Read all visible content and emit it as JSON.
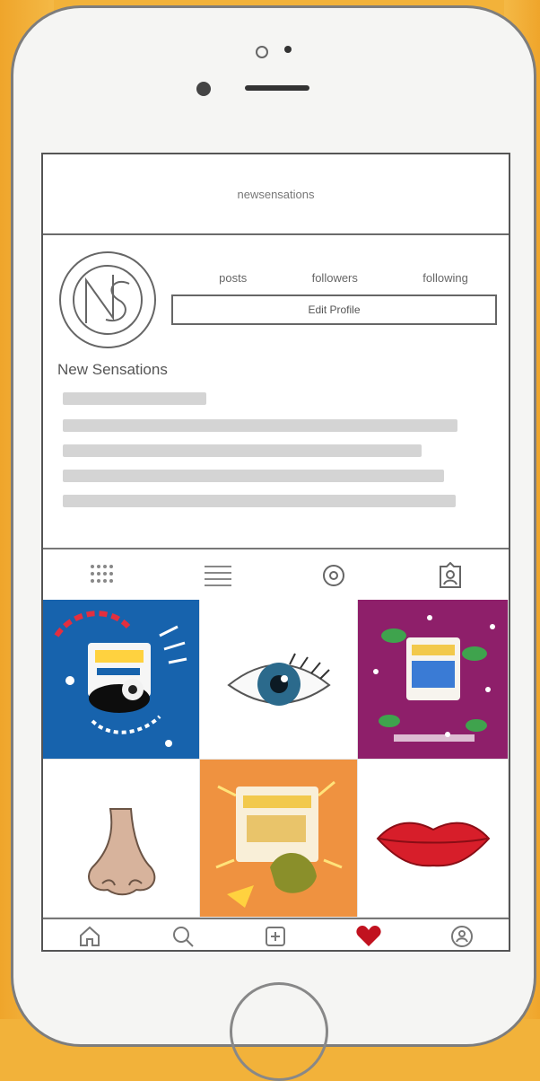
{
  "header": {
    "username": "newsensations"
  },
  "profile": {
    "stats": [
      {
        "label": "posts"
      },
      {
        "label": "followers"
      },
      {
        "label": "following"
      }
    ],
    "edit_button_label": "Edit Profile",
    "display_name": "New Sensations"
  },
  "tabs": [
    {
      "name": "grid",
      "icon": "grid-icon"
    },
    {
      "name": "list",
      "icon": "list-icon"
    },
    {
      "name": "location",
      "icon": "location-icon"
    },
    {
      "name": "tagged",
      "icon": "tagged-icon"
    }
  ],
  "posts": [
    {
      "subject": "blue poster",
      "color": "#1763ad"
    },
    {
      "subject": "eye",
      "color": "#2b6a8c"
    },
    {
      "subject": "magenta poster",
      "color": "#8e1f6a"
    },
    {
      "subject": "nose",
      "color": "#d7b39c"
    },
    {
      "subject": "orange poster",
      "color": "#ef9240"
    },
    {
      "subject": "lips",
      "color": "#d71e2a"
    }
  ],
  "bottom_nav": [
    {
      "name": "home",
      "icon": "home-icon"
    },
    {
      "name": "search",
      "icon": "search-icon"
    },
    {
      "name": "add",
      "icon": "add-post-icon"
    },
    {
      "name": "activity",
      "icon": "heart-icon",
      "color": "#c1121f"
    },
    {
      "name": "profile",
      "icon": "profile-icon"
    }
  ]
}
